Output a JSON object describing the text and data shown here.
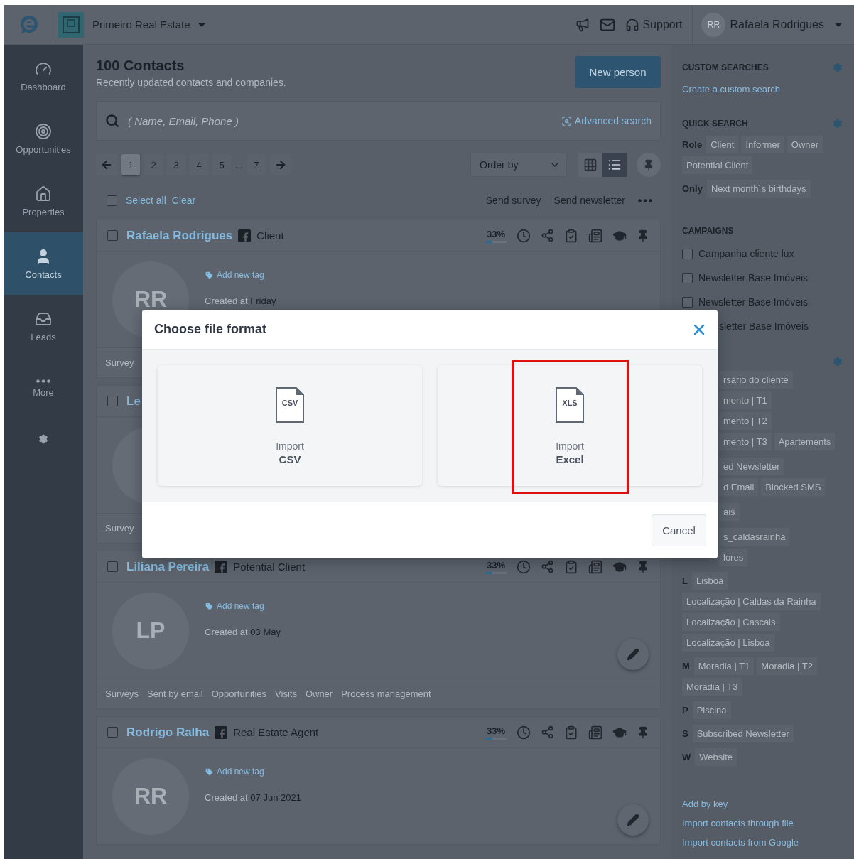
{
  "topbar": {
    "company": "Primeiro Real Estate",
    "support": "Support",
    "user_initials": "RR",
    "user_name": "Rafaela Rodrigues"
  },
  "nav": [
    {
      "label": "Dashboard",
      "selected": false
    },
    {
      "label": "Opportunities",
      "selected": false
    },
    {
      "label": "Properties",
      "selected": false
    },
    {
      "label": "Contacts",
      "selected": true
    },
    {
      "label": "Leads",
      "selected": false
    },
    {
      "label": "More",
      "selected": false
    }
  ],
  "header": {
    "title": "100 Contacts",
    "subtitle": "Recently updated contacts and companies.",
    "new_button": "New person"
  },
  "search": {
    "placeholder": "( Name, Email, Phone )",
    "advanced": "Advanced search"
  },
  "pagination": {
    "pages": [
      {
        "label": "1",
        "selected": true
      },
      {
        "label": "2",
        "selected": false
      },
      {
        "label": "3",
        "selected": false
      },
      {
        "label": "4",
        "selected": false
      },
      {
        "label": "5",
        "selected": false
      },
      {
        "label": "...",
        "kind": "gap"
      },
      {
        "label": "7",
        "selected": false
      }
    ]
  },
  "order_by": "Order by",
  "view": [
    {
      "kind": "grid",
      "selected": false
    },
    {
      "kind": "list",
      "selected": true
    }
  ],
  "bulk": {
    "checked": false,
    "select_all": "Select all",
    "clear": "Clear",
    "actions": [
      "Send survey",
      "Send newsletter"
    ]
  },
  "contacts": [
    {
      "checked": false,
      "name": "Rafaela Rodrigues",
      "facebook": true,
      "role": "Client",
      "percent": "33%",
      "level": 0.33,
      "initials": "RR",
      "tag_link": "Add new tag",
      "created_label": "Created at",
      "created": "Friday",
      "footer": [
        "Survey"
      ]
    },
    {
      "checked": false,
      "name": "Le",
      "footer": [
        "Survey"
      ]
    },
    {
      "checked": false,
      "name": "Liliana Pereira",
      "facebook": true,
      "role": "Potential Client",
      "percent": "33%",
      "level": 0.33,
      "initials": "LP",
      "tag_link": "Add new tag",
      "created_label": "Created at",
      "created": "03 May",
      "edit": true,
      "footer": [
        "Surveys",
        "Sent by email",
        "Opportunities",
        "Visits",
        "Owner",
        "Process management"
      ]
    },
    {
      "checked": false,
      "name": "Rodrigo Ralha",
      "facebook": true,
      "role": "Real Estate Agent",
      "percent": "33%",
      "level": 0.33,
      "initials": "RR",
      "tag_link": "Add new tag",
      "created_label": "Created at",
      "created": "07 Jun 2021",
      "edit": true
    }
  ],
  "sidebar": {
    "custom_searches": {
      "title": "CUSTOM SEARCHES",
      "link": "Create a custom search"
    },
    "quick_search": {
      "title": "QUICK SEARCH",
      "groups": [
        {
          "label": "Role",
          "tags": [
            "Client",
            "Informer",
            "Owner",
            "Potential Client"
          ]
        },
        {
          "label": "Only",
          "tags": [
            "Next month´s birthdays"
          ]
        }
      ]
    },
    "campaigns": {
      "title": "CAMPAIGNS",
      "items": [
        {
          "label": "Campanha cliente lux",
          "checked": false
        },
        {
          "label": "Newsletter Base Imóveis",
          "checked": false
        },
        {
          "label": "Newsletter Base Imóveis",
          "checked": false
        }
      ],
      "partial_item": "sletter Base Imóveis"
    },
    "tags_behind_dialog": [
      [
        "rsário do cliente"
      ],
      [
        "mento | T1"
      ],
      [
        "mento | T2"
      ],
      [
        "mento | T3",
        "Apartements"
      ],
      [
        "ed Newsletter"
      ],
      [
        "d Email",
        "Blocked SMS"
      ],
      [
        "ais"
      ],
      [
        "s_caldasrainha"
      ],
      [
        "lores"
      ]
    ],
    "tag_groups": [
      {
        "letter": "L",
        "tags": [
          "Lisboa",
          "Localização | Caldas da Rainha",
          "Localização | Cascais",
          "Localização | Lisboa"
        ]
      },
      {
        "letter": "M",
        "tags": [
          "Moradia | T1",
          "Moradia | T2",
          "Moradia | T3"
        ]
      },
      {
        "letter": "P",
        "tags": [
          "Piscina"
        ]
      },
      {
        "letter": "S",
        "tags": [
          "Subscribed Newsletter"
        ]
      },
      {
        "letter": "W",
        "tags": [
          "Website"
        ]
      }
    ],
    "links": [
      "Add by key",
      "Import contacts through file",
      "Import contacts from Google"
    ]
  },
  "dialog": {
    "title": "Choose file format",
    "options": [
      {
        "badge": "CSV",
        "label": "Import",
        "format": "CSV",
        "highlighted": false
      },
      {
        "badge": "XLS",
        "label": "Import",
        "format": "Excel",
        "highlighted": true
      }
    ],
    "cancel": "Cancel"
  }
}
